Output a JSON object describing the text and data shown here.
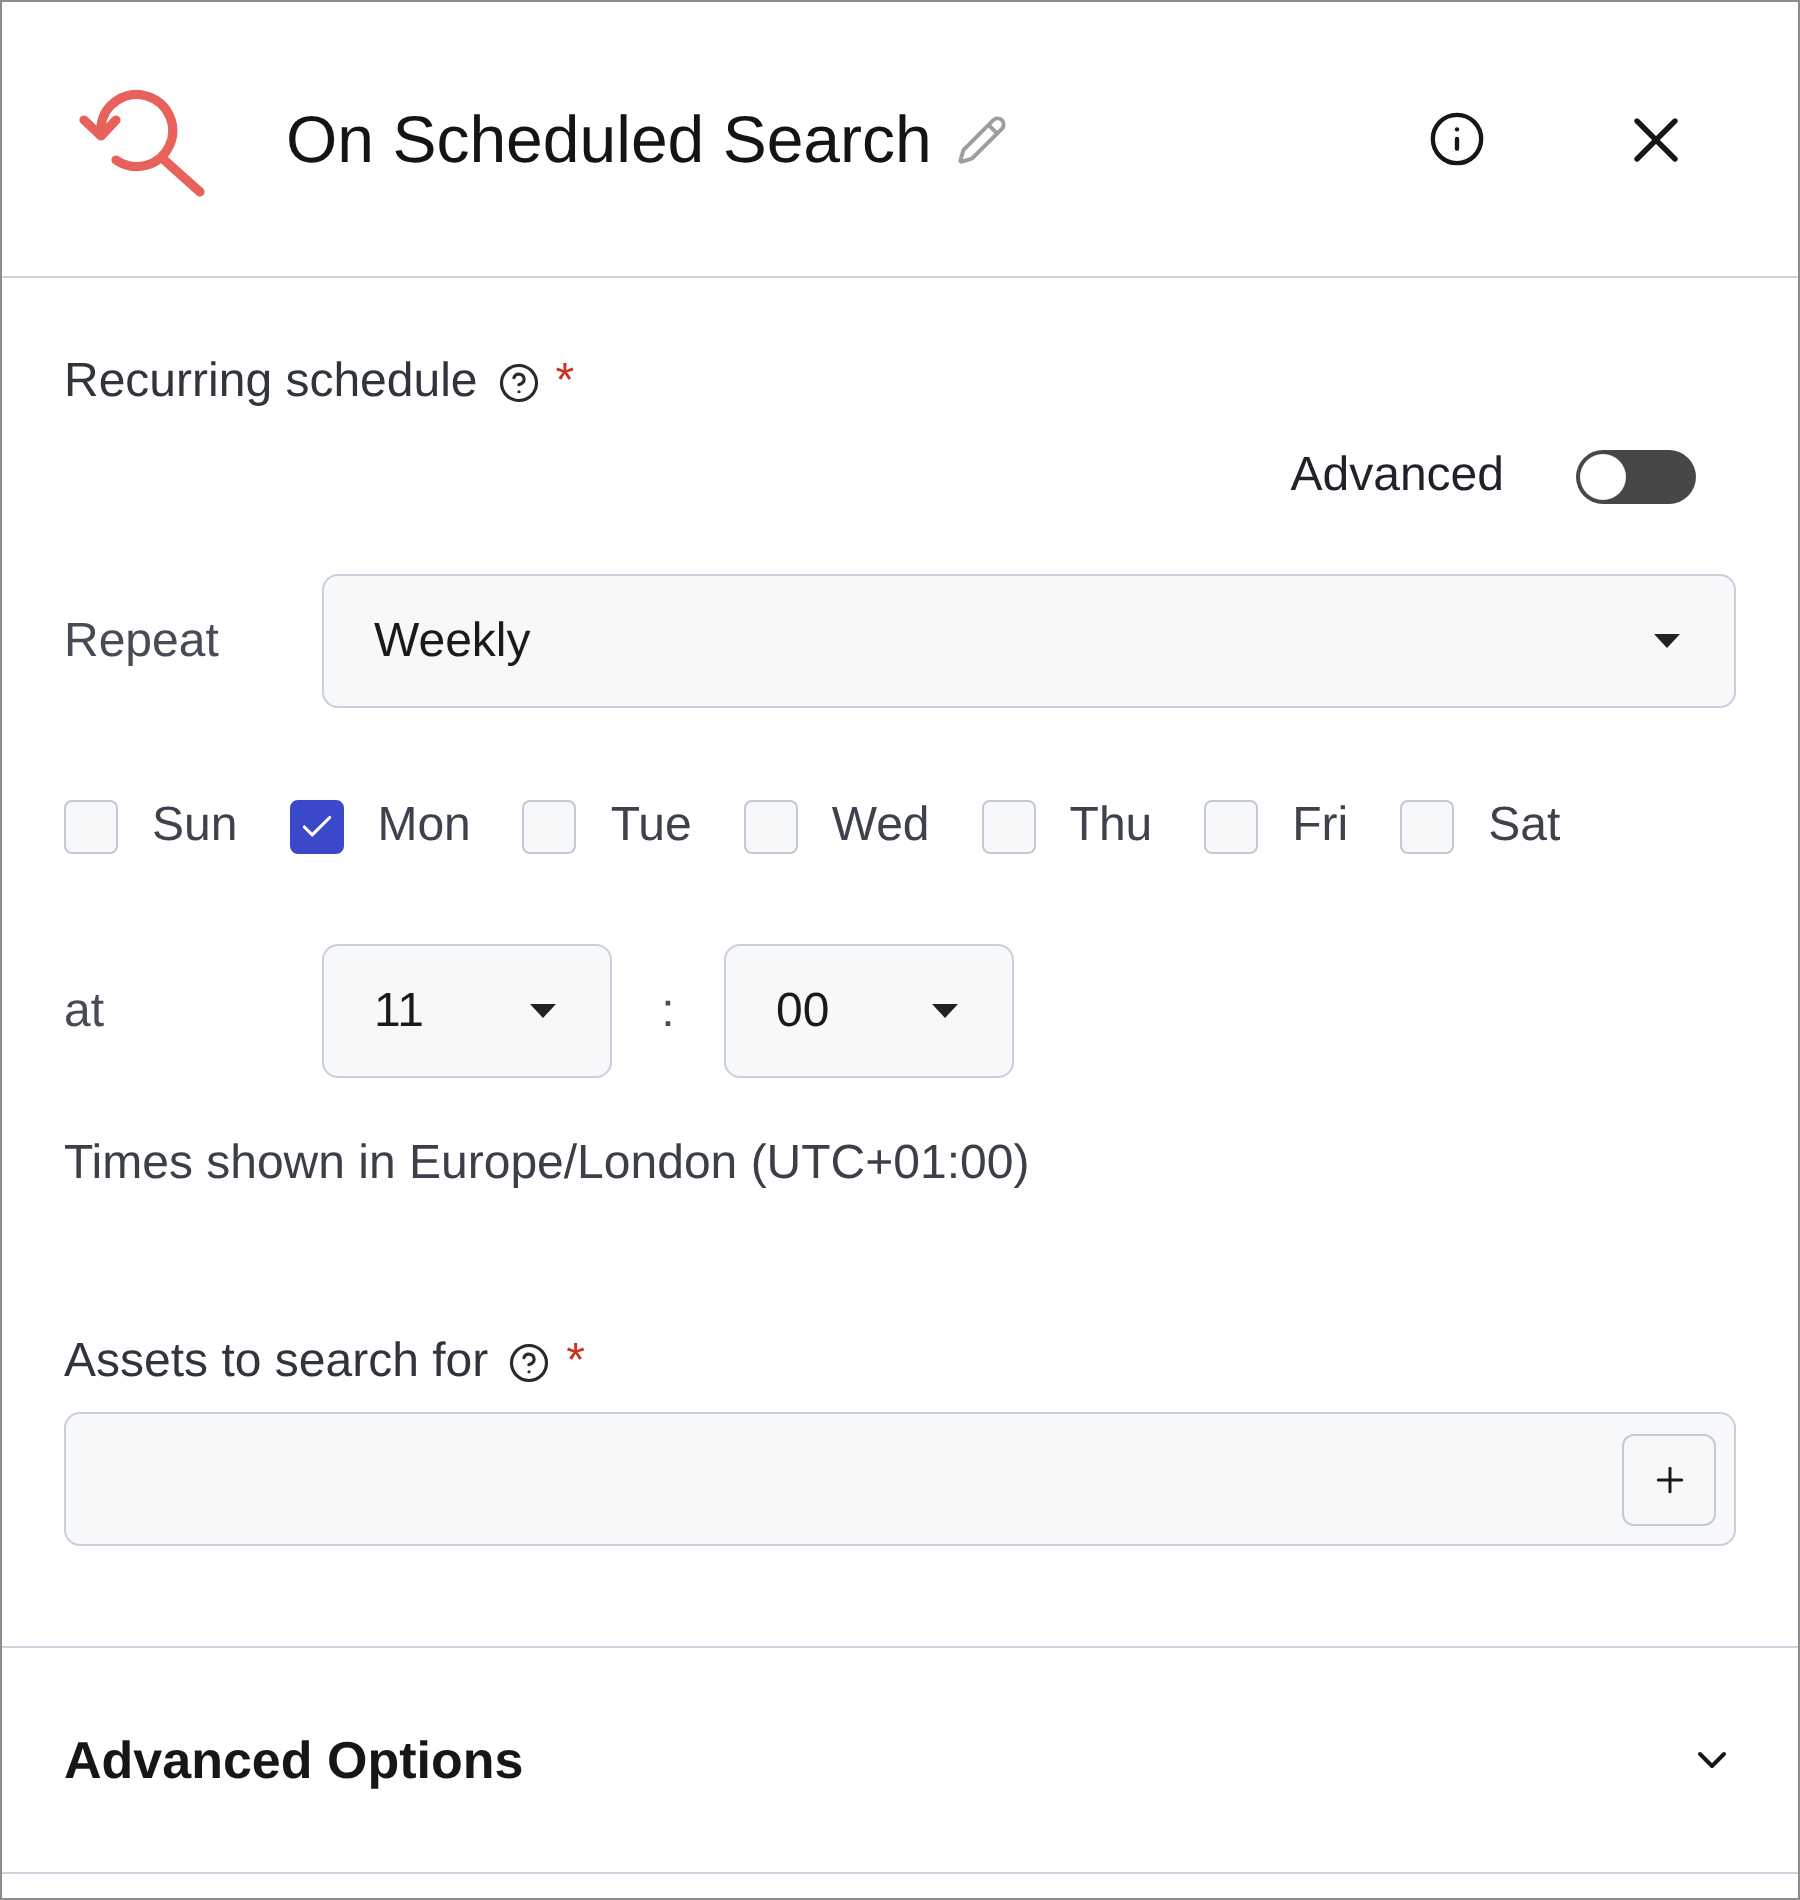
{
  "header": {
    "title": "On Scheduled Search"
  },
  "schedule": {
    "label": "Recurring schedule",
    "required_mark": "*",
    "advanced_toggle": {
      "label": "Advanced",
      "on": false
    },
    "repeat": {
      "label": "Repeat",
      "value": "Weekly"
    },
    "days": [
      {
        "label": "Sun",
        "checked": false
      },
      {
        "label": "Mon",
        "checked": true
      },
      {
        "label": "Tue",
        "checked": false
      },
      {
        "label": "Wed",
        "checked": false
      },
      {
        "label": "Thu",
        "checked": false
      },
      {
        "label": "Fri",
        "checked": false
      },
      {
        "label": "Sat",
        "checked": false
      }
    ],
    "time": {
      "label": "at",
      "hour": "11",
      "separator": ":",
      "minute": "00"
    },
    "timezone_note": "Times shown in Europe/London (UTC+01:00)"
  },
  "assets": {
    "label": "Assets to search for",
    "required_mark": "*"
  },
  "advanced_options": {
    "title": "Advanced Options",
    "expanded": false
  }
}
